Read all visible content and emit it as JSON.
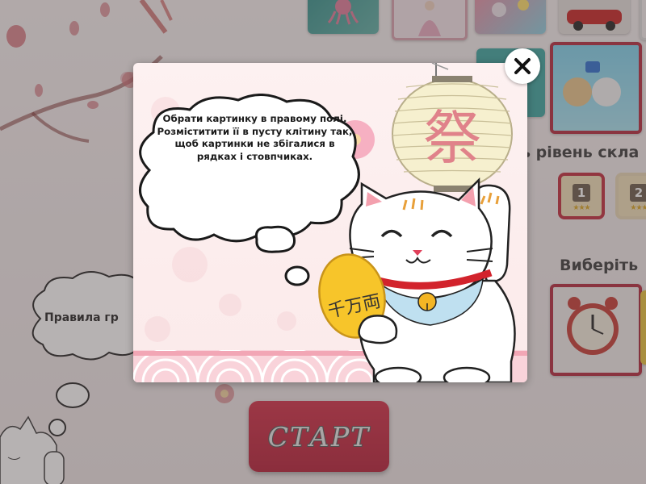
{
  "background": {
    "difficulty_title": "ь рівень скла",
    "choose_title": "Виберіть",
    "rules_label": "Правила гр",
    "start_label": "СТАРТ",
    "levels": [
      {
        "num": "1",
        "stars": "★★★"
      },
      {
        "num": "2",
        "stars": "★★★"
      }
    ]
  },
  "modal": {
    "instruction": "Обрати картинку в правому полі. Розміститити її в пусту клітину так, щоб картинки не збігалися в рядках і стовпчиках.",
    "lantern_glyph": "祭",
    "coin_glyph": "千万両"
  },
  "colors": {
    "accent": "#c22a3c",
    "start_button": "#c52139",
    "overlay": "rgba(80,72,72,0.42)"
  }
}
